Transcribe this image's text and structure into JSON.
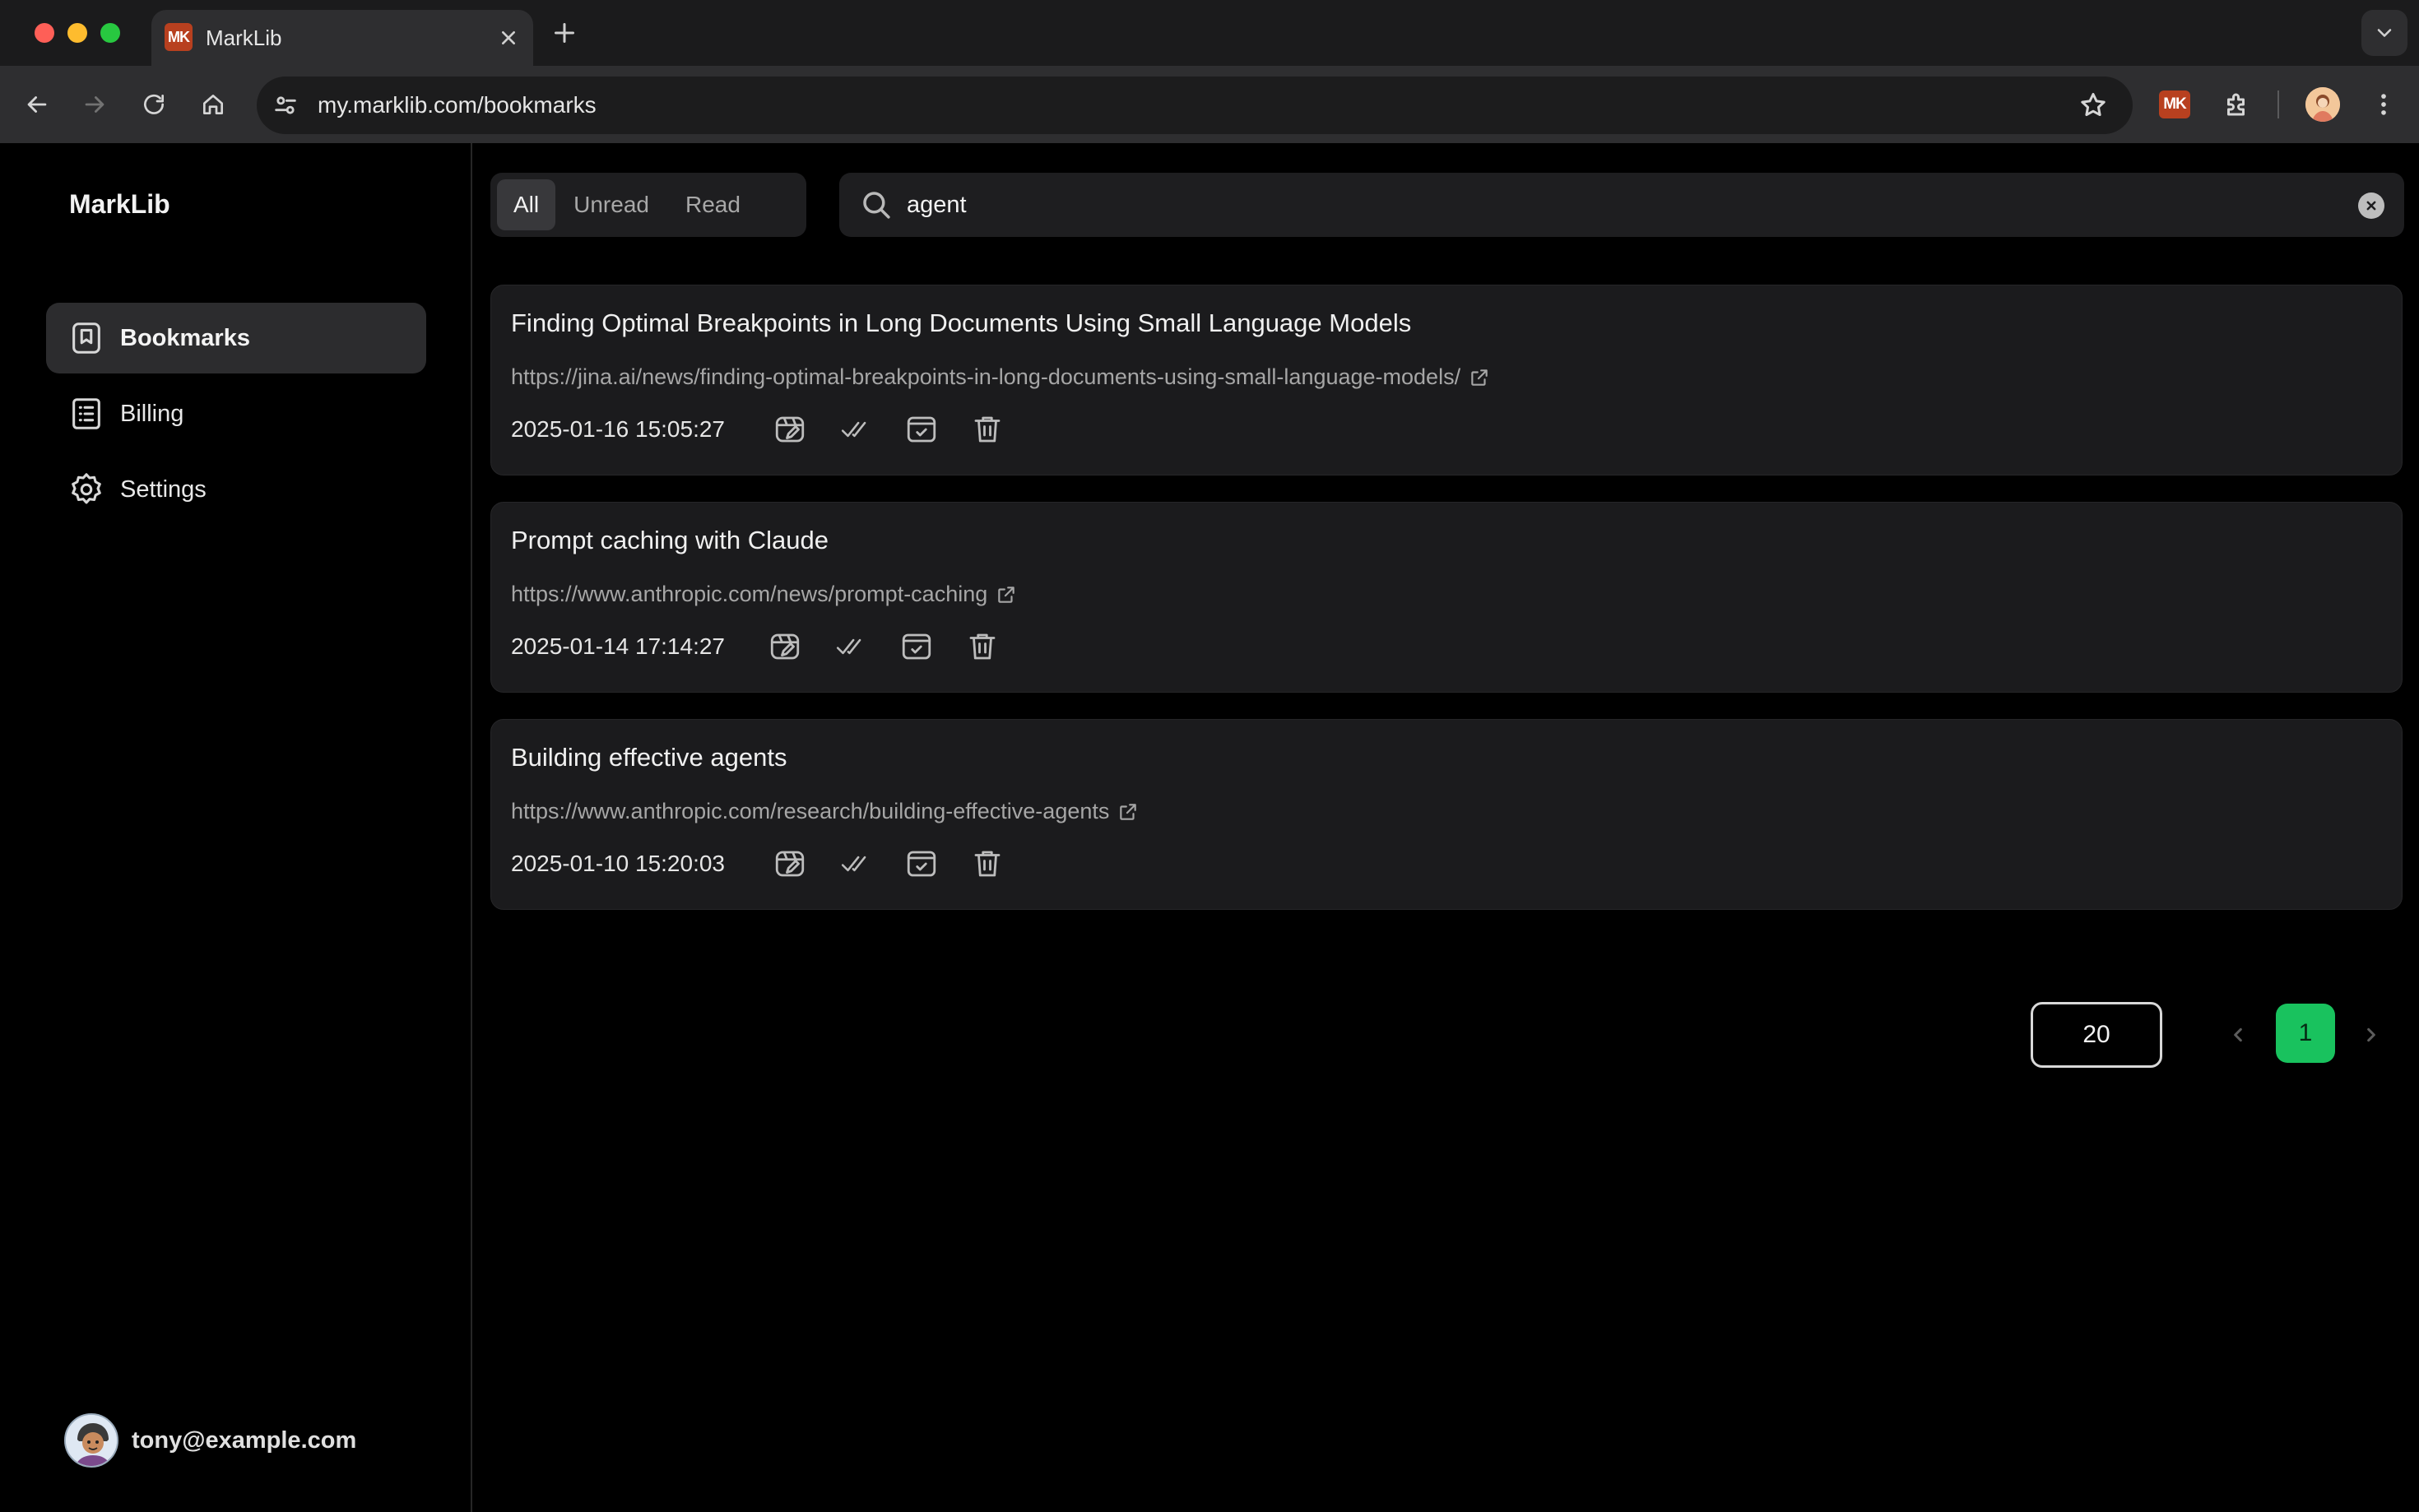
{
  "browser": {
    "tab_title": "MarkLib",
    "favicon_text": "MK",
    "url": "my.marklib.com/bookmarks",
    "extension_badge": "MK"
  },
  "sidebar": {
    "brand": "MarkLib",
    "items": [
      {
        "label": "Bookmarks",
        "icon": "bookmark-icon",
        "active": true
      },
      {
        "label": "Billing",
        "icon": "receipt-icon",
        "active": false
      },
      {
        "label": "Settings",
        "icon": "gear-icon",
        "active": false
      }
    ],
    "user_email": "tony@example.com"
  },
  "filters": {
    "options": [
      "All",
      "Unread",
      "Read"
    ],
    "selected": "All"
  },
  "search": {
    "value": "agent"
  },
  "bookmarks": [
    {
      "title": "Finding Optimal Breakpoints in Long Documents Using Small Language Models",
      "url": "https://jina.ai/news/finding-optimal-breakpoints-in-long-documents-using-small-language-models/",
      "date": "2025-01-16 15:05:27"
    },
    {
      "title": "Prompt caching with Claude",
      "url": "https://www.anthropic.com/news/prompt-caching",
      "date": "2025-01-14 17:14:27"
    },
    {
      "title": "Building effective agents",
      "url": "https://www.anthropic.com/research/building-effective-agents",
      "date": "2025-01-10 15:20:03"
    }
  ],
  "pagination": {
    "page_size": "20",
    "current_page": "1"
  },
  "colors": {
    "background": "#000000",
    "card": "#1b1b1d",
    "accent_green": "#19c25e",
    "brand_orange": "#b8401f"
  }
}
